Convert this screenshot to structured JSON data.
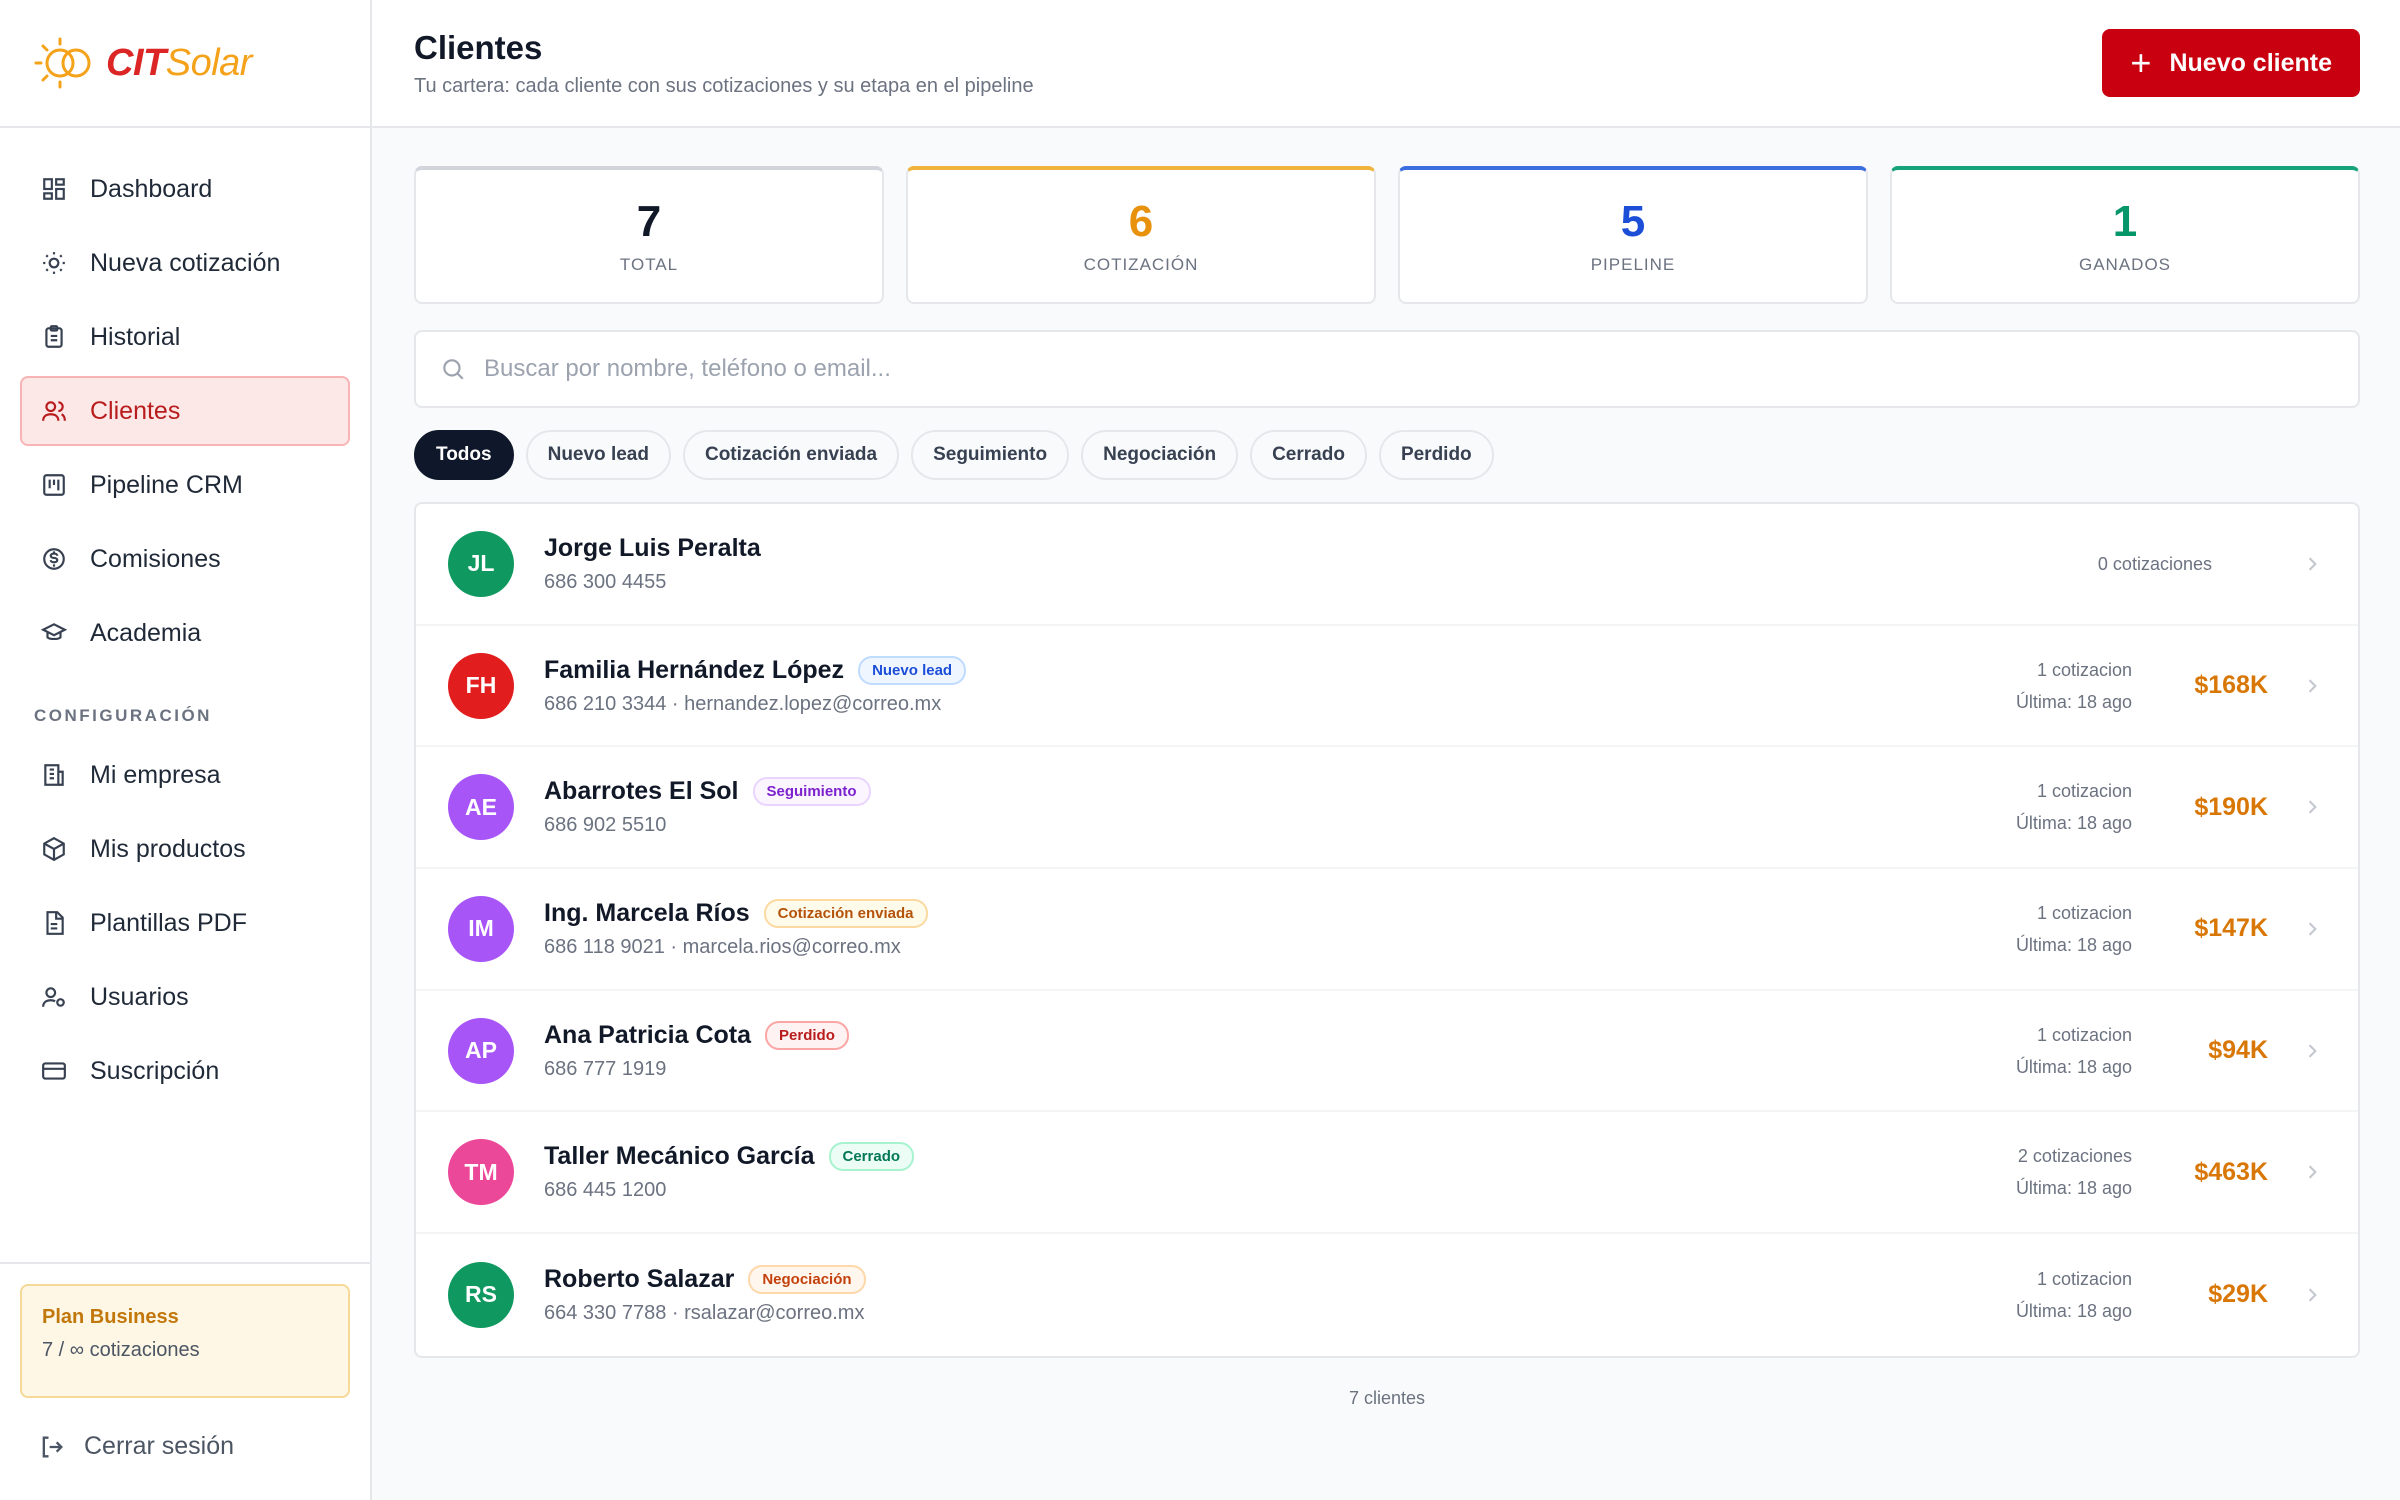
{
  "brand": {
    "cit": "CIT",
    "solar": "Solar",
    "color_primary": "#dc2626",
    "color_accent": "#f5a21b"
  },
  "sidebar": {
    "items": [
      {
        "label": "Dashboard",
        "icon": "dashboard-icon"
      },
      {
        "label": "Nueva cotización",
        "icon": "sun-icon"
      },
      {
        "label": "Historial",
        "icon": "clipboard-icon"
      },
      {
        "label": "Clientes",
        "icon": "users-icon",
        "active": true
      },
      {
        "label": "Pipeline CRM",
        "icon": "kanban-icon"
      },
      {
        "label": "Comisiones",
        "icon": "dollar-circle-icon"
      },
      {
        "label": "Academia",
        "icon": "graduation-cap-icon"
      }
    ],
    "config_label": "CONFIGURACIÓN",
    "config_items": [
      {
        "label": "Mi empresa",
        "icon": "building-icon"
      },
      {
        "label": "Mis productos",
        "icon": "package-icon"
      },
      {
        "label": "Plantillas PDF",
        "icon": "file-icon"
      },
      {
        "label": "Usuarios",
        "icon": "user-cog-icon"
      },
      {
        "label": "Suscripción",
        "icon": "credit-card-icon"
      }
    ],
    "plan": {
      "title": "Plan Business",
      "usage": "7 / ∞ cotizaciones"
    },
    "logout": "Cerrar sesión"
  },
  "header": {
    "title": "Clientes",
    "subtitle": "Tu cartera: cada cliente con sus cotizaciones y su etapa en el pipeline",
    "new_button": "Nuevo cliente"
  },
  "stats": [
    {
      "value": "7",
      "label": "TOTAL",
      "color": "#111827",
      "border": "#d1d5db"
    },
    {
      "value": "6",
      "label": "COTIZACIÓN",
      "color": "#e8910c",
      "border": "#f0b43c"
    },
    {
      "value": "5",
      "label": "PIPELINE",
      "color": "#1d4ed8",
      "border": "#3b6fe0"
    },
    {
      "value": "1",
      "label": "GANADOS",
      "color": "#059669",
      "border": "#16a37c"
    }
  ],
  "search": {
    "placeholder": "Buscar por nombre, teléfono o email..."
  },
  "filters": [
    "Todos",
    "Nuevo lead",
    "Cotización enviada",
    "Seguimiento",
    "Negociación",
    "Cerrado",
    "Perdido"
  ],
  "clients": [
    {
      "initials": "JL",
      "name": "Jorge Luis Peralta",
      "badge": "",
      "contact": "686 300 4455",
      "quotes": "0 cotizaciones",
      "last": "",
      "amount": "",
      "avatar_color": "#0f9960"
    },
    {
      "initials": "FH",
      "name": "Familia Hernández López",
      "badge": "Nuevo lead",
      "badge_type": "blue",
      "contact": "686 210 3344 · hernandez.lopez@correo.mx",
      "quotes": "1 cotizacion",
      "last": "Última: 18 ago",
      "amount": "$168K",
      "avatar_color": "#e11d1d"
    },
    {
      "initials": "AE",
      "name": "Abarrotes El Sol",
      "badge": "Seguimiento",
      "badge_type": "purple",
      "contact": "686 902 5510",
      "quotes": "1 cotizacion",
      "last": "Última: 18 ago",
      "amount": "$190K",
      "avatar_color": "#a855f7"
    },
    {
      "initials": "IM",
      "name": "Ing. Marcela Ríos",
      "badge": "Cotización enviada",
      "badge_type": "amber",
      "contact": "686 118 9021 · marcela.rios@correo.mx",
      "quotes": "1 cotizacion",
      "last": "Última: 18 ago",
      "amount": "$147K",
      "avatar_color": "#a855f7"
    },
    {
      "initials": "AP",
      "name": "Ana Patricia Cota",
      "badge": "Perdido",
      "badge_type": "red",
      "contact": "686 777 1919",
      "quotes": "1 cotizacion",
      "last": "Última: 18 ago",
      "amount": "$94K",
      "avatar_color": "#a855f7"
    },
    {
      "initials": "TM",
      "name": "Taller Mecánico García",
      "badge": "Cerrado",
      "badge_type": "green",
      "contact": "686 445 1200",
      "quotes": "2 cotizaciones",
      "last": "Última: 18 ago",
      "amount": "$463K",
      "avatar_color": "#ec4899"
    },
    {
      "initials": "RS",
      "name": "Roberto Salazar",
      "badge": "Negociación",
      "badge_type": "orange",
      "contact": "664 330 7788 · rsalazar@correo.mx",
      "quotes": "1 cotizacion",
      "last": "Última: 18 ago",
      "amount": "$29K",
      "avatar_color": "#0f9960"
    }
  ],
  "footer": {
    "count": "7 clientes"
  }
}
